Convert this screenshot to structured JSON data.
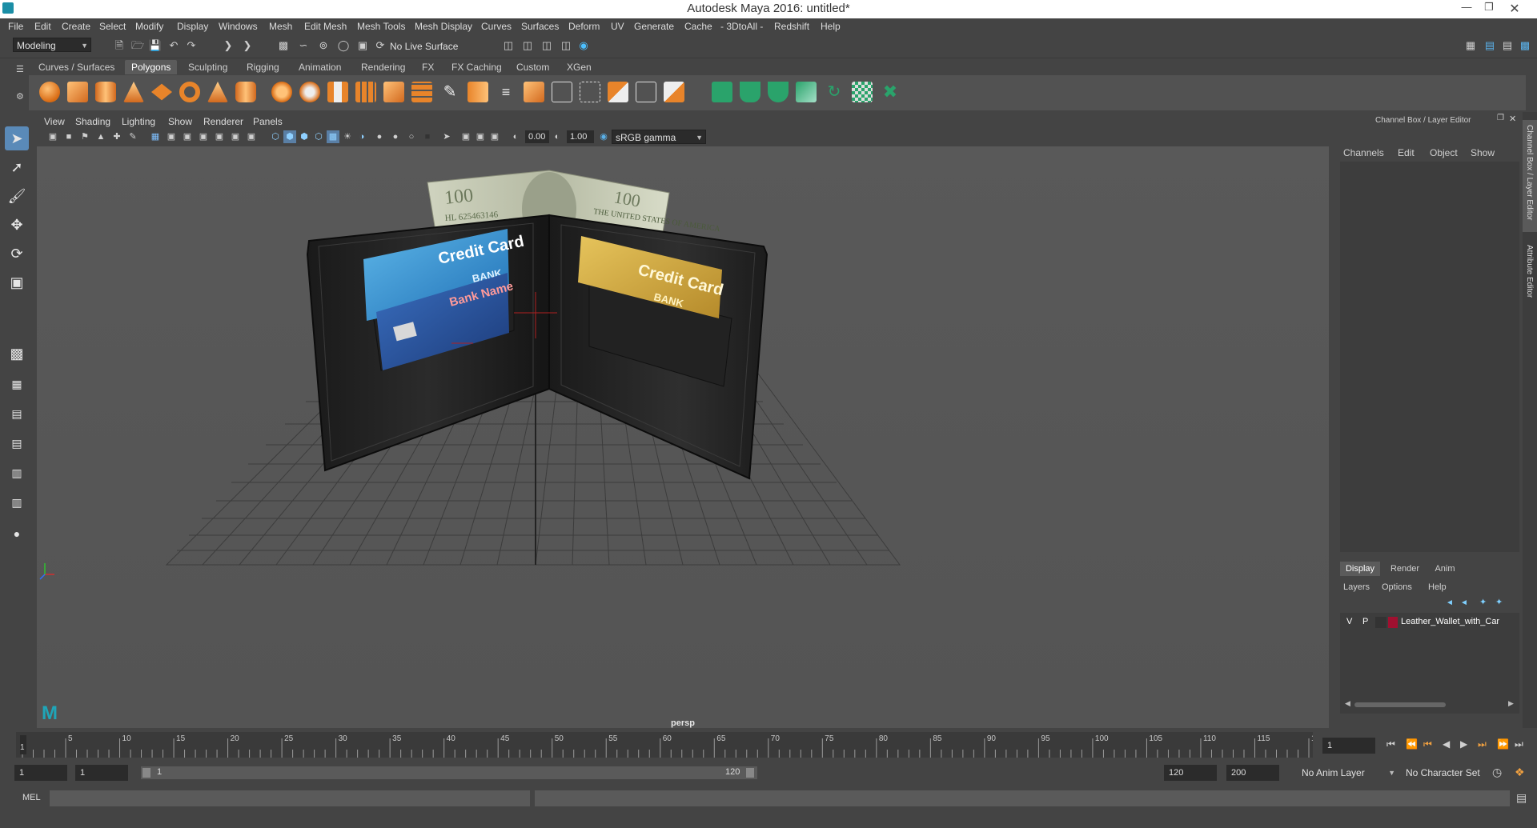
{
  "window": {
    "title": "Autodesk Maya 2016: untitled*"
  },
  "menubar": [
    "File",
    "Edit",
    "Create",
    "Select",
    "Modify",
    "Display",
    "Windows",
    "Mesh",
    "Edit Mesh",
    "Mesh Tools",
    "Mesh Display",
    "Curves",
    "Surfaces",
    "Deform",
    "UV",
    "Generate",
    "Cache",
    "- 3DtoAll -",
    "Redshift",
    "Help"
  ],
  "statusline": {
    "mode": "Modeling",
    "live_surface": "No Live Surface"
  },
  "shelf": {
    "tabs": [
      "Curves / Surfaces",
      "Polygons",
      "Sculpting",
      "Rigging",
      "Animation",
      "Rendering",
      "FX",
      "FX Caching",
      "Custom",
      "XGen"
    ],
    "active_tab": "Polygons"
  },
  "viewport": {
    "menus": [
      "View",
      "Shading",
      "Lighting",
      "Show",
      "Renderer",
      "Panels"
    ],
    "exposure": "0.00",
    "gamma": "1.00",
    "color_space": "sRGB gamma",
    "camera_label": "persp",
    "card1_title": "Credit Card",
    "card1_line": "BANK",
    "card2_title": "Bank Name",
    "card3_title": "Credit Card",
    "card3_line": "BANK",
    "bill_serial": "HL 625463146",
    "bill_denom": "100",
    "bill_text": "THE UNITED STATES OF AMERICA"
  },
  "channel_box": {
    "header": "Channel Box / Layer Editor",
    "menus": [
      "Channels",
      "Edit",
      "Object",
      "Show"
    ],
    "layer_tabs": [
      "Display",
      "Render",
      "Anim"
    ],
    "active_layer_tab": "Display",
    "layer_menus": [
      "Layers",
      "Options",
      "Help"
    ],
    "layers": [
      {
        "v": "V",
        "p": "P",
        "name": "Leather_Wallet_with_Car",
        "color": "#a01030"
      }
    ],
    "side_tabs": [
      "Channel Box / Layer Editor",
      "Attribute Editor"
    ]
  },
  "timeline": {
    "ticks": [
      "5",
      "10",
      "15",
      "20",
      "25",
      "30",
      "35",
      "40",
      "45",
      "50",
      "55",
      "60",
      "65",
      "70",
      "75",
      "80",
      "85",
      "90",
      "95",
      "100",
      "105",
      "110",
      "115",
      "120"
    ],
    "current_frame_marker": "1",
    "current_frame": "1"
  },
  "range": {
    "start": "1",
    "playback_start": "1",
    "slider_start": "1",
    "slider_end": "120",
    "playback_end": "120",
    "end": "200",
    "anim_layer": "No Anim Layer",
    "character_set": "No Character Set"
  },
  "command_line": {
    "label": "MEL"
  }
}
